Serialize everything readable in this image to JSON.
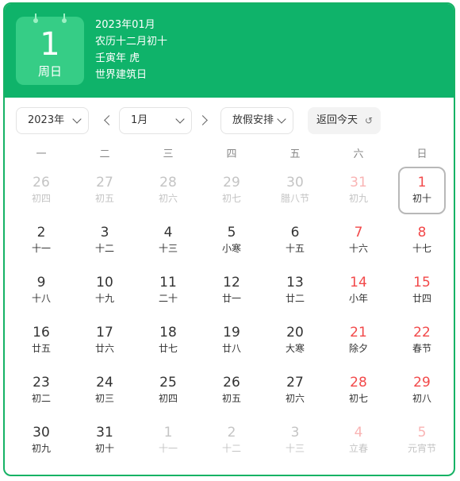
{
  "header": {
    "big_day": "1",
    "weekday": "周日",
    "info_lines": [
      "2023年01月",
      "农历十二月初十",
      "壬寅年 虎",
      "世界建筑日"
    ]
  },
  "toolbar": {
    "year_value": "2023年",
    "month_value": "1月",
    "holiday_label": "放假安排",
    "today_label": "返回今天",
    "today_icon": "undo-icon"
  },
  "weekdays": [
    "一",
    "二",
    "三",
    "四",
    "五",
    "六",
    "日"
  ],
  "days": [
    {
      "day": "26",
      "lunar": "初四",
      "other": true,
      "weekend": false
    },
    {
      "day": "27",
      "lunar": "初五",
      "other": true,
      "weekend": false
    },
    {
      "day": "28",
      "lunar": "初六",
      "other": true,
      "weekend": false
    },
    {
      "day": "29",
      "lunar": "初七",
      "other": true,
      "weekend": false
    },
    {
      "day": "30",
      "lunar": "腊八节",
      "other": true,
      "weekend": false
    },
    {
      "day": "31",
      "lunar": "初九",
      "other": true,
      "weekend": true
    },
    {
      "day": "1",
      "lunar": "初十",
      "other": false,
      "weekend": true,
      "today": true
    },
    {
      "day": "2",
      "lunar": "十一",
      "other": false,
      "weekend": false
    },
    {
      "day": "3",
      "lunar": "十二",
      "other": false,
      "weekend": false
    },
    {
      "day": "4",
      "lunar": "十三",
      "other": false,
      "weekend": false
    },
    {
      "day": "5",
      "lunar": "小寒",
      "other": false,
      "weekend": false
    },
    {
      "day": "6",
      "lunar": "十五",
      "other": false,
      "weekend": false
    },
    {
      "day": "7",
      "lunar": "十六",
      "other": false,
      "weekend": true
    },
    {
      "day": "8",
      "lunar": "十七",
      "other": false,
      "weekend": true
    },
    {
      "day": "9",
      "lunar": "十八",
      "other": false,
      "weekend": false
    },
    {
      "day": "10",
      "lunar": "十九",
      "other": false,
      "weekend": false
    },
    {
      "day": "11",
      "lunar": "二十",
      "other": false,
      "weekend": false
    },
    {
      "day": "12",
      "lunar": "廿一",
      "other": false,
      "weekend": false
    },
    {
      "day": "13",
      "lunar": "廿二",
      "other": false,
      "weekend": false
    },
    {
      "day": "14",
      "lunar": "小年",
      "other": false,
      "weekend": true
    },
    {
      "day": "15",
      "lunar": "廿四",
      "other": false,
      "weekend": true
    },
    {
      "day": "16",
      "lunar": "廿五",
      "other": false,
      "weekend": false
    },
    {
      "day": "17",
      "lunar": "廿六",
      "other": false,
      "weekend": false
    },
    {
      "day": "18",
      "lunar": "廿七",
      "other": false,
      "weekend": false
    },
    {
      "day": "19",
      "lunar": "廿八",
      "other": false,
      "weekend": false
    },
    {
      "day": "20",
      "lunar": "大寒",
      "other": false,
      "weekend": false
    },
    {
      "day": "21",
      "lunar": "除夕",
      "other": false,
      "weekend": true
    },
    {
      "day": "22",
      "lunar": "春节",
      "other": false,
      "weekend": true
    },
    {
      "day": "23",
      "lunar": "初二",
      "other": false,
      "weekend": false
    },
    {
      "day": "24",
      "lunar": "初三",
      "other": false,
      "weekend": false
    },
    {
      "day": "25",
      "lunar": "初四",
      "other": false,
      "weekend": false
    },
    {
      "day": "26",
      "lunar": "初五",
      "other": false,
      "weekend": false
    },
    {
      "day": "27",
      "lunar": "初六",
      "other": false,
      "weekend": false
    },
    {
      "day": "28",
      "lunar": "初七",
      "other": false,
      "weekend": true
    },
    {
      "day": "29",
      "lunar": "初八",
      "other": false,
      "weekend": true
    },
    {
      "day": "30",
      "lunar": "初九",
      "other": false,
      "weekend": false
    },
    {
      "day": "31",
      "lunar": "初十",
      "other": false,
      "weekend": false
    },
    {
      "day": "1",
      "lunar": "十一",
      "other": true,
      "weekend": false
    },
    {
      "day": "2",
      "lunar": "十二",
      "other": true,
      "weekend": false
    },
    {
      "day": "3",
      "lunar": "十三",
      "other": true,
      "weekend": false
    },
    {
      "day": "4",
      "lunar": "立春",
      "other": true,
      "weekend": true
    },
    {
      "day": "5",
      "lunar": "元宵节",
      "other": true,
      "weekend": true
    }
  ],
  "colors": {
    "header_green": "#0fb36a",
    "weekend_red": "#f2494a",
    "muted_gray": "#c4c4c4"
  }
}
